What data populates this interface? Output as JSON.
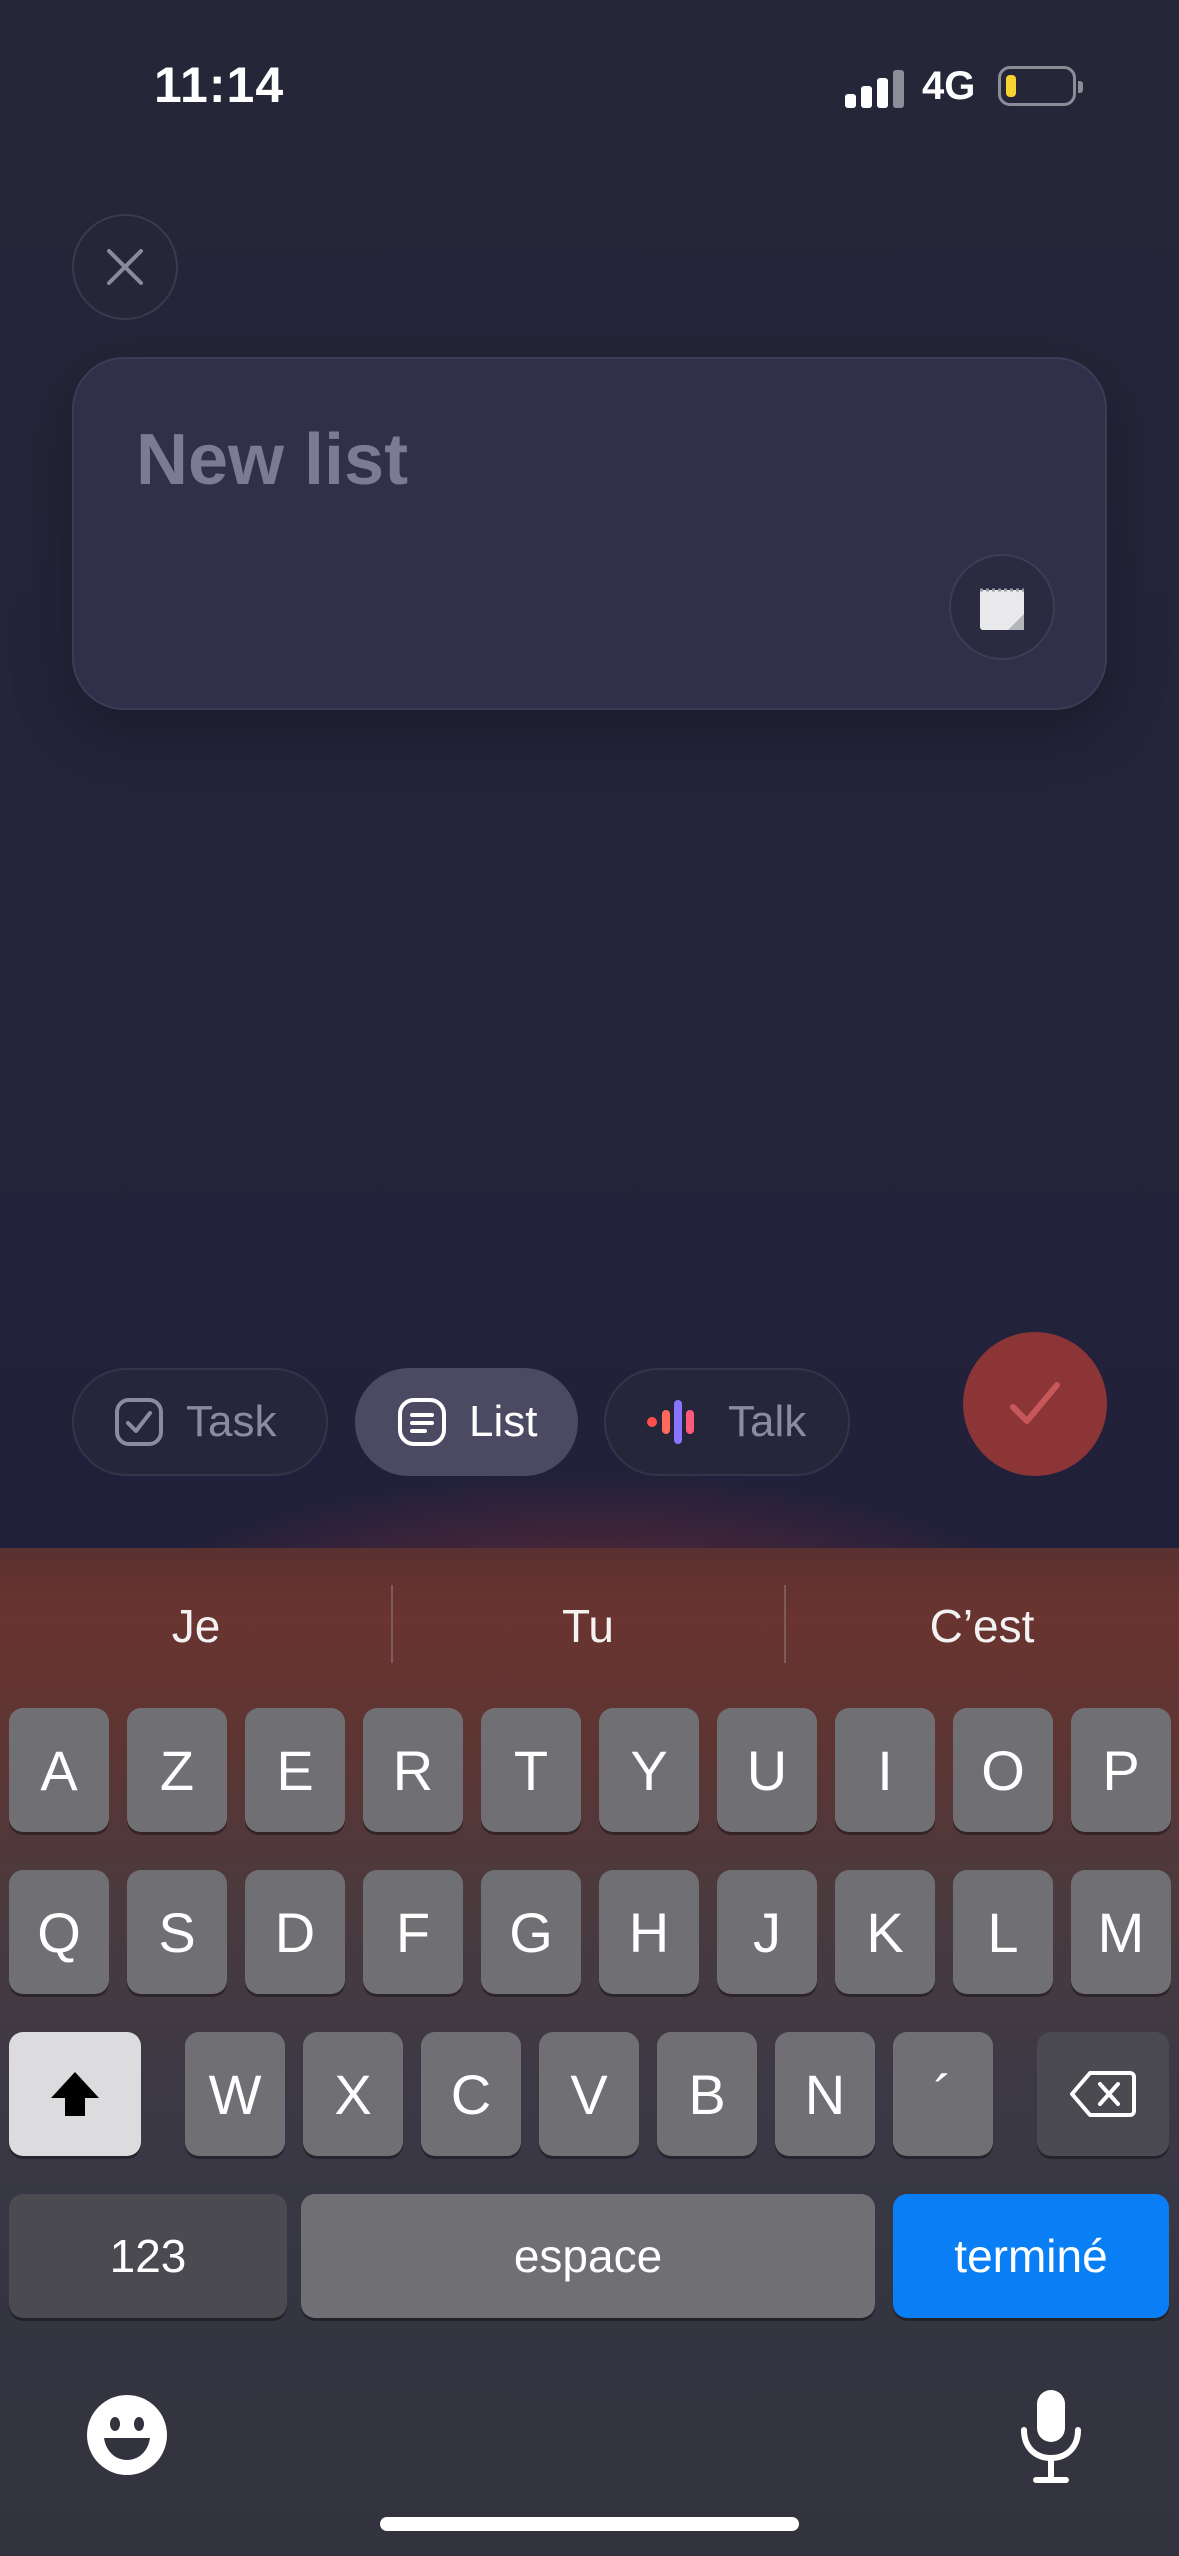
{
  "status_bar": {
    "time": "11:14",
    "network": "4G"
  },
  "editor": {
    "title_placeholder": "New list"
  },
  "modes": [
    {
      "label": "Task",
      "icon": "checkbox-icon",
      "active": false
    },
    {
      "label": "List",
      "icon": "list-icon",
      "active": true
    },
    {
      "label": "Talk",
      "icon": "voice-icon",
      "active": false
    }
  ],
  "suggestions": [
    "Je",
    "Tu",
    "C’est"
  ],
  "keyboard": {
    "row1": [
      "A",
      "Z",
      "E",
      "R",
      "T",
      "Y",
      "U",
      "I",
      "O",
      "P"
    ],
    "row2": [
      "Q",
      "S",
      "D",
      "F",
      "G",
      "H",
      "J",
      "K",
      "L",
      "M"
    ],
    "row3": [
      "W",
      "X",
      "C",
      "V",
      "B",
      "N",
      "´"
    ],
    "numbers_label": "123",
    "space_label": "espace",
    "return_label": "terminé"
  },
  "colors": {
    "accent_confirm": "#8c3536",
    "return_key": "#0a7ff5",
    "battery_low": "#f7d230"
  }
}
